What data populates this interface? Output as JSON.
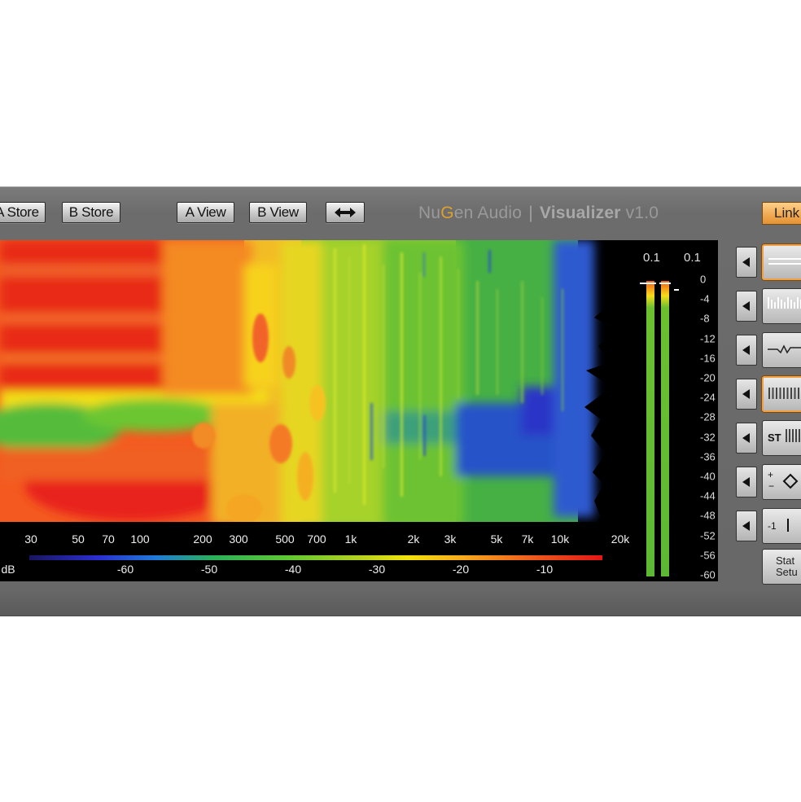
{
  "toolbar": {
    "a_store": "A Store",
    "b_store": "B Store",
    "a_view": "A View",
    "b_view": "B View",
    "swap_icon": "double-arrow-icon"
  },
  "brand": {
    "nu": "Nu",
    "g": "G",
    "en_audio": "en Audio",
    "separator": "|",
    "product": "Visualizer",
    "version": "v1.0",
    "accent": "#e0a12a"
  },
  "link_label": "Link",
  "frequency_axis": [
    "30",
    "50",
    "70",
    "100",
    "200",
    "300",
    "500",
    "700",
    "1k",
    "2k",
    "3k",
    "5k",
    "7k",
    "10k",
    "20k"
  ],
  "db_legend": {
    "unit": "dB",
    "ticks": [
      "-60",
      "-50",
      "-40",
      "-30",
      "-20",
      "-10"
    ]
  },
  "meter": {
    "left_peak": "0.1",
    "right_peak": "0.1",
    "scale": [
      "0",
      "-4",
      "-8",
      "-12",
      "-16",
      "-20",
      "-24",
      "-28",
      "-32",
      "-36",
      "-40",
      "-44",
      "-48",
      "-52",
      "-56",
      "-60"
    ]
  },
  "side_modes": [
    {
      "icon": "line-mode-icon",
      "selected": true
    },
    {
      "icon": "bars-mode-icon",
      "selected": false
    },
    {
      "icon": "wave-mode-icon",
      "selected": false
    },
    {
      "icon": "spectrogram-mode-icon",
      "selected": true
    },
    {
      "icon": "stereo-mode-icon",
      "label": "ST",
      "selected": false
    },
    {
      "icon": "phase-mode-icon",
      "selected": false
    },
    {
      "icon": "correlation-mode-icon",
      "selected": false
    }
  ],
  "status_button": {
    "line1": "Stat",
    "line2": "Setu"
  }
}
